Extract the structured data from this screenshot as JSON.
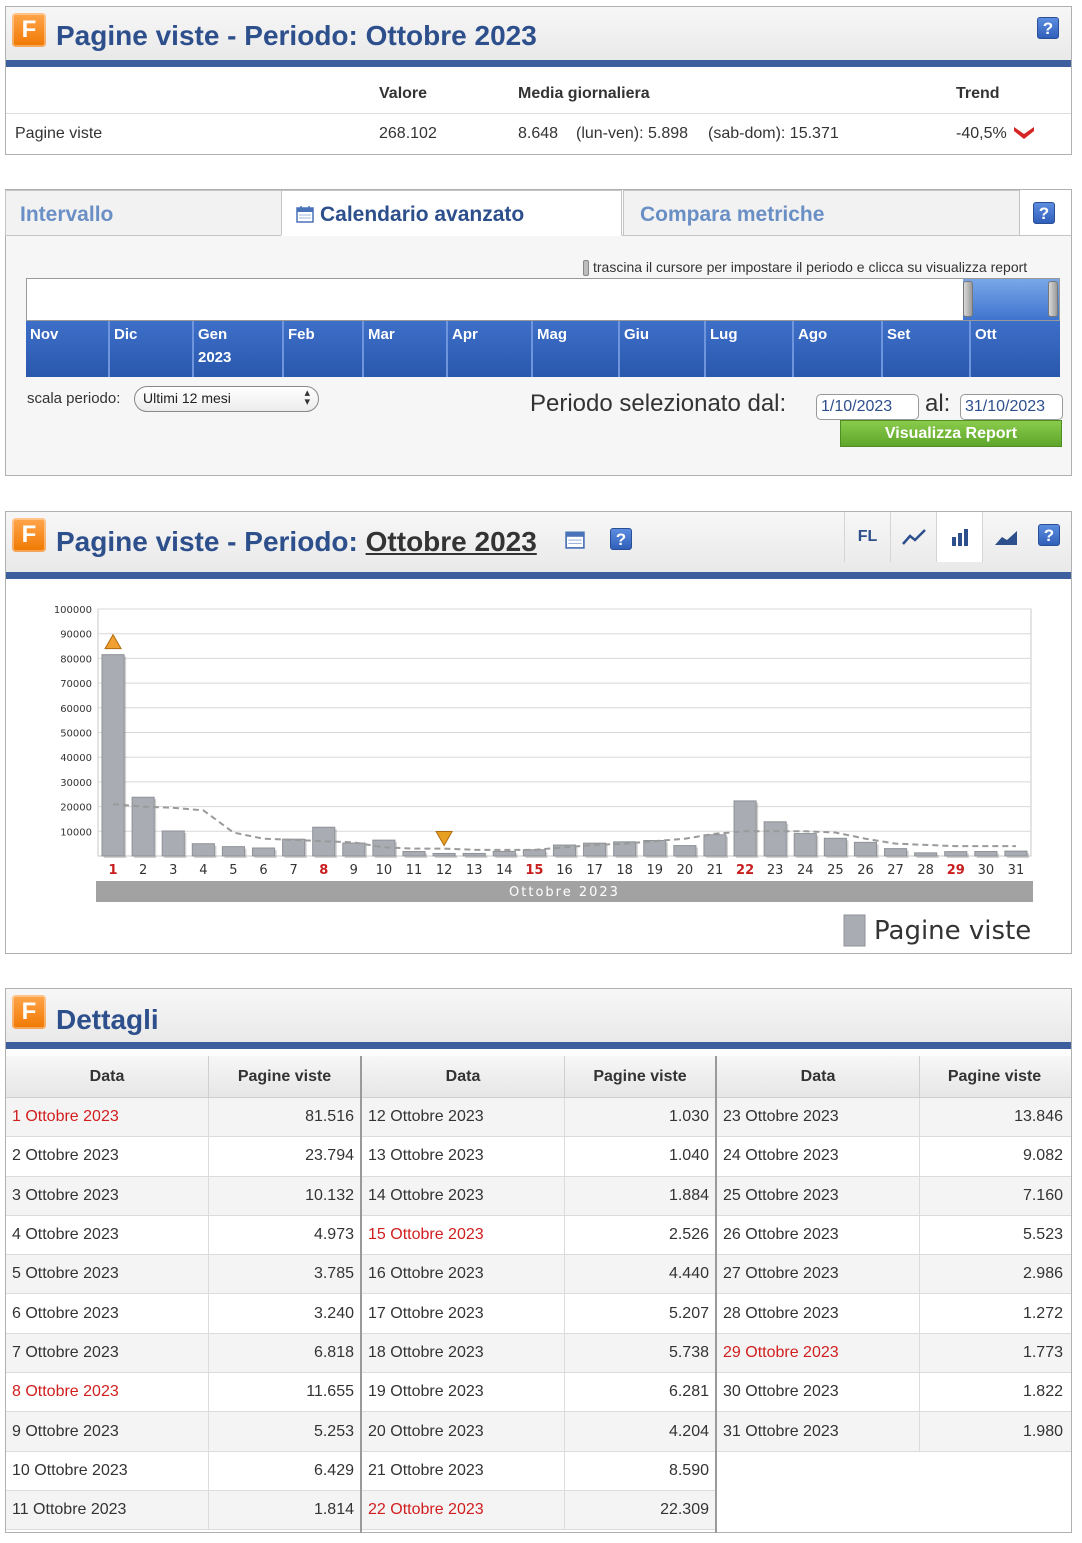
{
  "summary": {
    "title": "Pagine viste - Periodo: Ottobre 2023",
    "help": "?",
    "headers": {
      "valore": "Valore",
      "media": "Media giornaliera",
      "trend": "Trend"
    },
    "row": {
      "label": "Pagine viste",
      "valore": "268.102",
      "media": "8.648",
      "lun_ven": "(lun-ven): 5.898",
      "sab_dom": "(sab-dom): 15.371",
      "trend": "-40,5%"
    }
  },
  "calendar": {
    "tabs": [
      "Intervallo",
      "Calendario avanzato",
      "Compara metriche"
    ],
    "hint": "trascina il cursore per impostare il periodo e clicca su visualizza report",
    "months": [
      "Nov",
      "Dic",
      "Gen",
      "Feb",
      "Mar",
      "Apr",
      "Mag",
      "Giu",
      "Lug",
      "Ago",
      "Set",
      "Ott"
    ],
    "year_label": "2023",
    "scale_label": "scala periodo:",
    "scale_value": "Ultimi 12 mesi",
    "period_label": "Periodo selezionato dal:",
    "from": "1/10/2023",
    "to_label": "al:",
    "to": "31/10/2023",
    "submit": "Visualizza Report"
  },
  "chart_panel": {
    "title_prefix": "Pagine viste - Periodo:",
    "title_period": "Ottobre 2023",
    "tools": [
      "FL"
    ],
    "help": "?"
  },
  "chart_data": {
    "type": "bar",
    "x_group_label": "Ottobre 2023",
    "categories": [
      "1",
      "2",
      "3",
      "4",
      "5",
      "6",
      "7",
      "8",
      "9",
      "10",
      "11",
      "12",
      "13",
      "14",
      "15",
      "16",
      "17",
      "18",
      "19",
      "20",
      "21",
      "22",
      "23",
      "24",
      "25",
      "26",
      "27",
      "28",
      "29",
      "30",
      "31"
    ],
    "weekend_days": [
      "1",
      "8",
      "15",
      "22",
      "29"
    ],
    "series": [
      {
        "name": "Pagine viste",
        "values": [
          81516,
          23794,
          10132,
          4973,
          3785,
          3240,
          6818,
          11655,
          5253,
          6429,
          1814,
          1030,
          1040,
          1884,
          2526,
          4440,
          5207,
          5738,
          6281,
          4204,
          8590,
          22309,
          13846,
          9082,
          7160,
          5523,
          2986,
          1272,
          1773,
          1822,
          1980
        ]
      }
    ],
    "trend_line": [
      21000,
      20000,
      19500,
      18500,
      9500,
      7000,
      6500,
      6000,
      5500,
      3500,
      3000,
      3000,
      2500,
      2500,
      2500,
      3500,
      4500,
      5000,
      6000,
      7000,
      9000,
      10000,
      10000,
      10000,
      9500,
      7000,
      5000,
      4500,
      4000,
      4000,
      4000
    ],
    "ylim": [
      0,
      100000
    ],
    "yticks": [
      100000,
      90000,
      80000,
      70000,
      60000,
      50000,
      40000,
      30000,
      20000,
      10000
    ],
    "max_marker_day": "1",
    "min_marker_day": "12",
    "grid": true,
    "legend_position": "bottom-right",
    "colors": {
      "bar": "#a9adb3",
      "trend": "#9a9a9a",
      "max": "#f0a030",
      "min": "#e8a020"
    }
  },
  "details": {
    "title": "Dettagli",
    "col_data": "Data",
    "col_views": "Pagine viste",
    "columns": [
      [
        {
          "date": "1 Ottobre 2023",
          "views": "81.516",
          "weekend": true
        },
        {
          "date": "2 Ottobre 2023",
          "views": "23.794",
          "weekend": false
        },
        {
          "date": "3 Ottobre 2023",
          "views": "10.132",
          "weekend": false
        },
        {
          "date": "4 Ottobre 2023",
          "views": "4.973",
          "weekend": false
        },
        {
          "date": "5 Ottobre 2023",
          "views": "3.785",
          "weekend": false
        },
        {
          "date": "6 Ottobre 2023",
          "views": "3.240",
          "weekend": false
        },
        {
          "date": "7 Ottobre 2023",
          "views": "6.818",
          "weekend": false
        },
        {
          "date": "8 Ottobre 2023",
          "views": "11.655",
          "weekend": true
        },
        {
          "date": "9 Ottobre 2023",
          "views": "5.253",
          "weekend": false
        },
        {
          "date": "10 Ottobre 2023",
          "views": "6.429",
          "weekend": false
        },
        {
          "date": "11 Ottobre 2023",
          "views": "1.814",
          "weekend": false
        }
      ],
      [
        {
          "date": "12 Ottobre 2023",
          "views": "1.030",
          "weekend": false
        },
        {
          "date": "13 Ottobre 2023",
          "views": "1.040",
          "weekend": false
        },
        {
          "date": "14 Ottobre 2023",
          "views": "1.884",
          "weekend": false
        },
        {
          "date": "15 Ottobre 2023",
          "views": "2.526",
          "weekend": true
        },
        {
          "date": "16 Ottobre 2023",
          "views": "4.440",
          "weekend": false
        },
        {
          "date": "17 Ottobre 2023",
          "views": "5.207",
          "weekend": false
        },
        {
          "date": "18 Ottobre 2023",
          "views": "5.738",
          "weekend": false
        },
        {
          "date": "19 Ottobre 2023",
          "views": "6.281",
          "weekend": false
        },
        {
          "date": "20 Ottobre 2023",
          "views": "4.204",
          "weekend": false
        },
        {
          "date": "21 Ottobre 2023",
          "views": "8.590",
          "weekend": false
        },
        {
          "date": "22 Ottobre 2023",
          "views": "22.309",
          "weekend": true
        }
      ],
      [
        {
          "date": "23 Ottobre 2023",
          "views": "13.846",
          "weekend": false
        },
        {
          "date": "24 Ottobre 2023",
          "views": "9.082",
          "weekend": false
        },
        {
          "date": "25 Ottobre 2023",
          "views": "7.160",
          "weekend": false
        },
        {
          "date": "26 Ottobre 2023",
          "views": "5.523",
          "weekend": false
        },
        {
          "date": "27 Ottobre 2023",
          "views": "2.986",
          "weekend": false
        },
        {
          "date": "28 Ottobre 2023",
          "views": "1.272",
          "weekend": false
        },
        {
          "date": "29 Ottobre 2023",
          "views": "1.773",
          "weekend": true
        },
        {
          "date": "30 Ottobre 2023",
          "views": "1.822",
          "weekend": false
        },
        {
          "date": "31 Ottobre 2023",
          "views": "1.980",
          "weekend": false
        }
      ]
    ]
  },
  "colors": {
    "brand_blue": "#2d4f8c",
    "header_bar": "#3e5f9d",
    "weekend_red": "#d11e1e",
    "accent_orange": "#f07800",
    "report_green": "#6ab434"
  }
}
